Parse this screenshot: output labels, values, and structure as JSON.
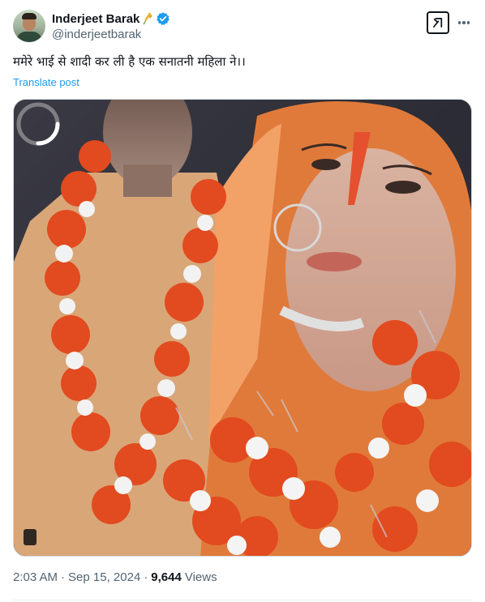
{
  "author": {
    "name": "Inderjeet Barak",
    "name_emoji_icon": "wheat-emoji-icon",
    "verified": true,
    "handle": "@inderjeetbarak",
    "avatar_icon": "profile-photo"
  },
  "actions": {
    "grok_icon": "grok-icon",
    "more_icon": "more-horizontal-icon"
  },
  "tweet": {
    "text": "ममेरे भाई से शादी कर ली है एक सनातनी महिला ने।।",
    "translate_label": "Translate post"
  },
  "media": {
    "type": "video",
    "loading_icon": "loading-spinner-icon"
  },
  "meta": {
    "time": "2:03 AM",
    "separator1": "·",
    "date": "Sep 15, 2024",
    "separator2": "·",
    "views_count": "9,644",
    "views_label": "Views"
  },
  "colors": {
    "link": "#1d9bf0",
    "verified": "#1d9bf0",
    "secondary_text": "#536471",
    "primary_text": "#0f1419"
  }
}
